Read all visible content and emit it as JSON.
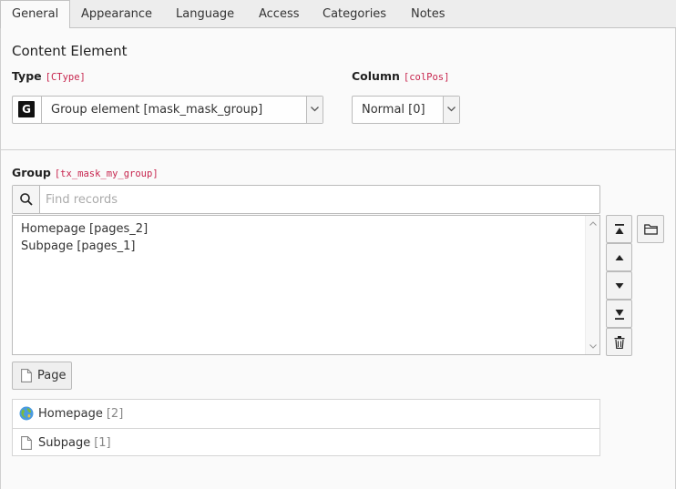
{
  "tabs": [
    {
      "label": "General",
      "active": true
    },
    {
      "label": "Appearance",
      "active": false
    },
    {
      "label": "Language",
      "active": false
    },
    {
      "label": "Access",
      "active": false
    },
    {
      "label": "Categories",
      "active": false
    },
    {
      "label": "Notes",
      "active": false
    }
  ],
  "section_title": "Content Element",
  "type_field": {
    "label": "Type",
    "code": "[CType]",
    "icon_letter": "G",
    "value": "Group element [mask_mask_group]"
  },
  "column_field": {
    "label": "Column",
    "code": "[colPos]",
    "value": "Normal [0]"
  },
  "group_field": {
    "label": "Group",
    "code": "[tx_mask_my_group]",
    "search_placeholder": "Find records",
    "selected_items": [
      "Homepage [pages_2]",
      "Subpage [pages_1]"
    ],
    "add_button_label": "Page"
  },
  "records": [
    {
      "name": "Homepage",
      "uid": "[2]",
      "icon": "globe-icon"
    },
    {
      "name": "Subpage",
      "uid": "[1]",
      "icon": "page-icon"
    }
  ],
  "colors": {
    "code_red": "#c7254e",
    "border": "#bbbbbb",
    "panel_bg": "#fafafa"
  }
}
